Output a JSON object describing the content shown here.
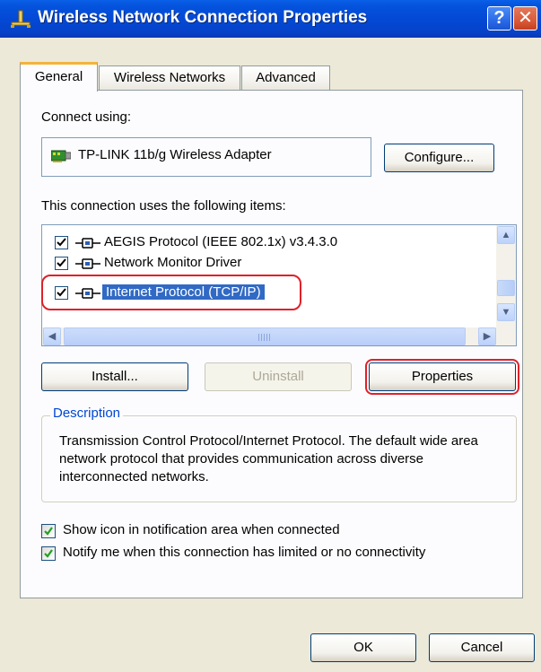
{
  "window": {
    "title": "Wireless Network Connection Properties",
    "help_label": "?",
    "close_label": "✕"
  },
  "tabs": [
    {
      "label": "General",
      "active": true
    },
    {
      "label": "Wireless Networks",
      "active": false
    },
    {
      "label": "Advanced",
      "active": false
    }
  ],
  "general": {
    "connect_using_label": "Connect using:",
    "adapter_name": "TP-LINK 11b/g Wireless Adapter",
    "configure_label": "Configure...",
    "items_label": "This connection uses the following items:",
    "items": [
      {
        "label": "AEGIS Protocol (IEEE 802.1x) v3.4.3.0",
        "checked": true,
        "selected": false
      },
      {
        "label": "Network Monitor Driver",
        "checked": true,
        "selected": false
      },
      {
        "label": "Internet Protocol (TCP/IP)",
        "checked": true,
        "selected": true
      }
    ],
    "scroll": {
      "up": "▲",
      "down": "▼",
      "left": "◀",
      "right": "▶"
    },
    "install_label": "Install...",
    "uninstall_label": "Uninstall",
    "properties_label": "Properties",
    "description_title": "Description",
    "description_text": "Transmission Control Protocol/Internet Protocol. The default wide area network protocol that provides communication across diverse interconnected networks.",
    "show_icon_label": "Show icon in notification area when connected",
    "show_icon_checked": true,
    "notify_label": "Notify me when this connection has limited or no connectivity",
    "notify_checked": true
  },
  "footer": {
    "ok_label": "OK",
    "cancel_label": "Cancel"
  },
  "colors": {
    "titlebar": "#0349d6",
    "selection": "#316ac5",
    "highlight": "#e0202a",
    "description_title": "#0046d5"
  },
  "icons": {
    "title": "network-connection-icon",
    "adapter": "network-adapter-icon",
    "protocol": "network-protocol-icon"
  }
}
